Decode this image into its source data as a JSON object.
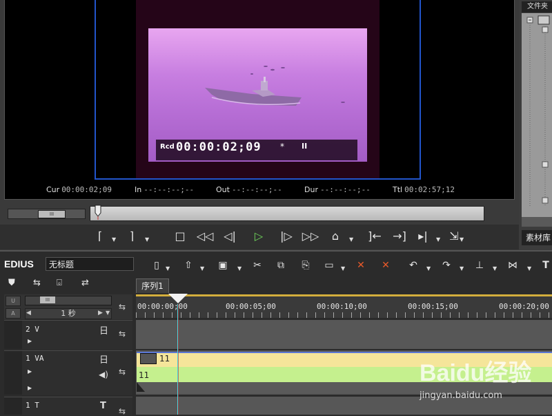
{
  "player": {
    "overlay_prefix": "Rcd",
    "overlay_timecode": "00:00:02;09",
    "overlay_star": "*",
    "overlay_pause": "II",
    "cur_label": "Cur",
    "cur_value": "00:00:02;09",
    "in_label": "In",
    "in_value": "--:--:--;--",
    "out_label": "Out",
    "out_value": "--:--:--;--",
    "dur_label": "Dur",
    "dur_value": "--:--:--;--",
    "ttl_label": "Ttl",
    "ttl_value": "00:02:57;12",
    "shuttle_knob": "III"
  },
  "bin": {
    "title": "文件夹",
    "label": "素材库"
  },
  "timeline": {
    "app_name": "EDIUS",
    "project_name": "无标题",
    "sequence_tab": "序列1",
    "zoom_label": "1 秒",
    "zoom_knob": "III",
    "ruler": [
      "00:00:00;00",
      "00:00:05;00",
      "00:00:10;00",
      "00:00:15;00",
      "00:00:20;00"
    ],
    "tracks": [
      {
        "name": "2 V"
      },
      {
        "name": "1 VA"
      },
      {
        "name": "1 T"
      }
    ],
    "clip_video_name": "11",
    "clip_audio_name": "11",
    "side_letters": [
      "U",
      "A"
    ]
  },
  "watermark": {
    "brand": "Baidu经验",
    "url": "jingyan.baidu.com"
  },
  "colors": {
    "accent_blue": "#2255cc",
    "play_green": "#6ed35a",
    "clip_video": "#f5e59a",
    "clip_audio": "#c5f08e",
    "ruler_gold": "#d4ae3c",
    "cursor_cyan": "#4ad6e0"
  }
}
